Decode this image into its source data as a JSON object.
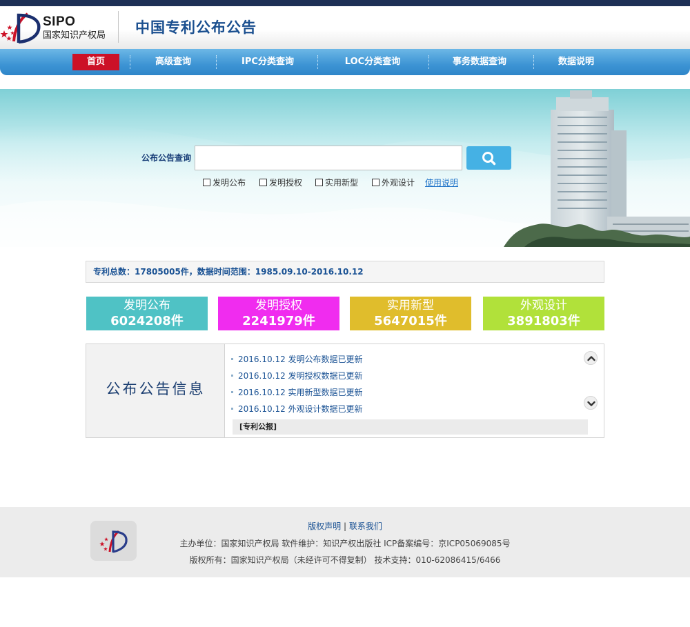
{
  "header": {
    "logo_text": "SIPO",
    "logo_cn": "国家知识产权局",
    "site_title": "中国专利公布公告"
  },
  "nav": {
    "items": [
      {
        "label": "首页",
        "active": true
      },
      {
        "label": "高级查询"
      },
      {
        "label": "IPC分类查询"
      },
      {
        "label": "LOC分类查询"
      },
      {
        "label": "事务数据查询"
      },
      {
        "label": "数据说明"
      }
    ]
  },
  "search": {
    "label": "公布公告查询",
    "value": "",
    "placeholder": "",
    "checkboxes": [
      {
        "label": "发明公布",
        "checked": false
      },
      {
        "label": "发明授权",
        "checked": false
      },
      {
        "label": "实用新型",
        "checked": false
      },
      {
        "label": "外观设计",
        "checked": false
      }
    ],
    "usage_link": "使用说明"
  },
  "stats": {
    "summary": "专利总数：17805005件，数据时间范围：1985.09.10-2016.10.12"
  },
  "tiles": [
    {
      "name": "发明公布",
      "count": "6024208件",
      "color": "#4fc2c5"
    },
    {
      "name": "发明授权",
      "count": "2241979件",
      "color": "#f02cef"
    },
    {
      "name": "实用新型",
      "count": "5647015件",
      "color": "#e0bd2c"
    },
    {
      "name": "外观设计",
      "count": "3891803件",
      "color": "#b1e13a"
    }
  ],
  "info": {
    "title": "公布公告信息",
    "news": [
      "2016.10.12 发明公布数据已更新",
      "2016.10.12 发明授权数据已更新",
      "2016.10.12 实用新型数据已更新",
      "2016.10.12 外观设计数据已更新"
    ],
    "gazette": "[专利公报]"
  },
  "footer": {
    "link_copyright": "版权声明",
    "link_sep": "|",
    "link_contact": "联系我们",
    "line1": "主办单位：国家知识产权局    软件维护：知识产权出版社    ICP备案编号：京ICP05069085号",
    "line2": "版权所有：国家知识产权局（未经许可不得复制）    技术支持：010-62086415/6466"
  },
  "colors": {
    "brand_blue": "#1a4f8f",
    "nav_blue": "#3d94d4",
    "nav_active": "#cc1127",
    "search_button": "#45b1e4",
    "topbar": "#1e3056"
  },
  "icons": {
    "search_button": "search-icon",
    "scroll_up": "chevron-up-icon",
    "scroll_down": "chevron-down-icon"
  }
}
